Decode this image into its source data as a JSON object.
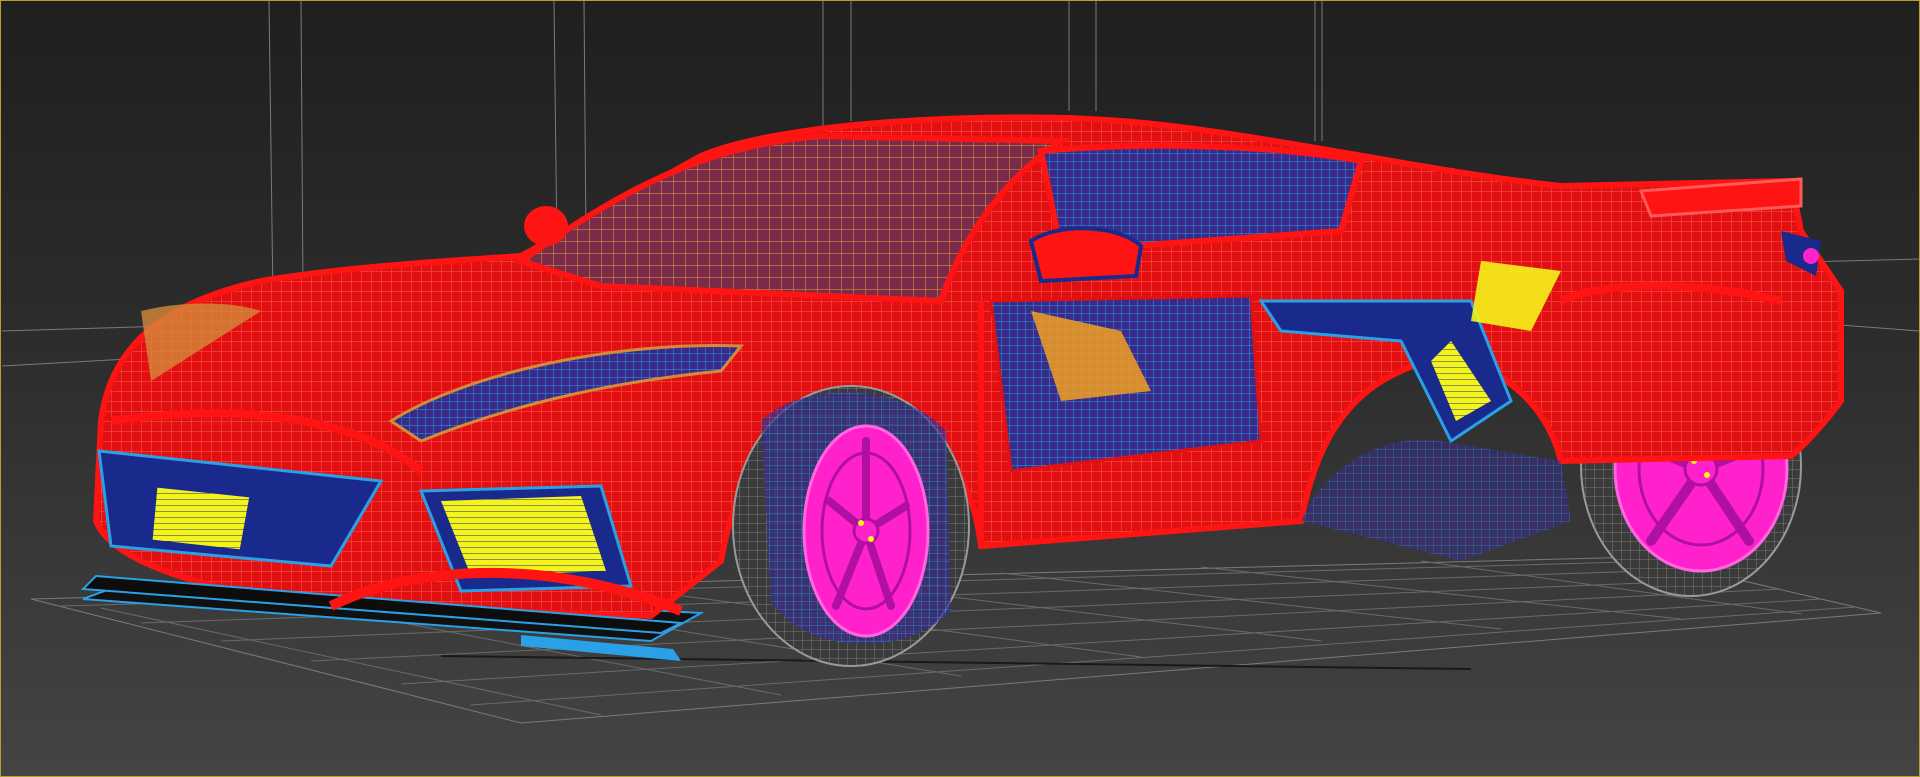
{
  "viewport": {
    "active_border_color": "#b8a12a",
    "background_top": "#1f1f1f",
    "background_bottom": "#444444"
  },
  "scene": {
    "object": "car-wireframe",
    "shading": "wireframe",
    "colors": {
      "body": "#ff1414",
      "wheels": "#ff22cc",
      "tires": "#8a8a8a",
      "grille_inserts": "#f4f41a",
      "trim": "#1a2a8c",
      "mesh_blue": "#2aa0e6",
      "glass_mesh": "#d58a3a",
      "grid": "#6a6a6a"
    }
  }
}
